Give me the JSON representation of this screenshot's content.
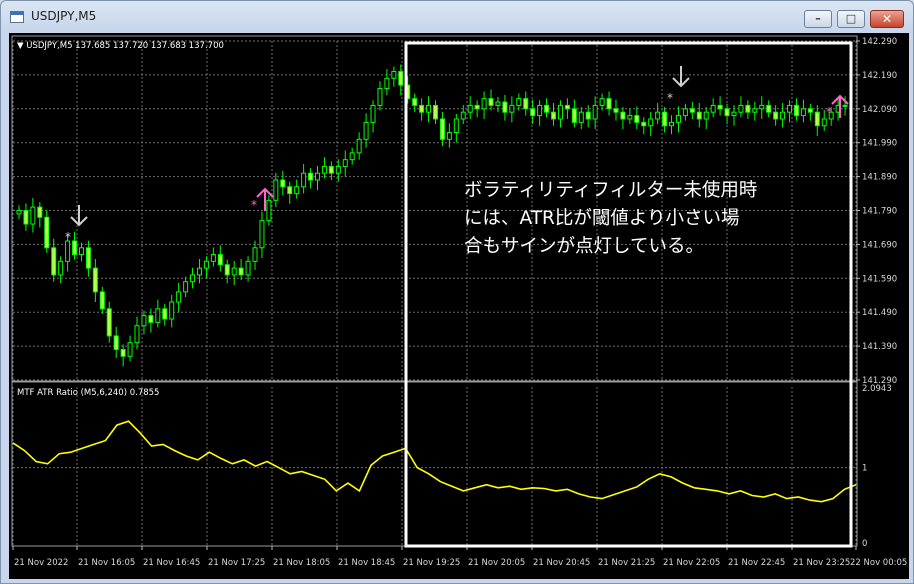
{
  "window": {
    "title": "USDJPY,M5",
    "icon": "chart-window-icon",
    "buttons": {
      "minimize": "–",
      "maximize": "□",
      "close": "✕"
    }
  },
  "price_panel": {
    "header": "▼ USDJPY,M5  137.685 137.720 137.683 137.700",
    "y_ticks": [
      "142.290",
      "142.190",
      "142.090",
      "141.990",
      "141.890",
      "141.790",
      "141.690",
      "141.590",
      "141.490",
      "141.390",
      "141.290"
    ]
  },
  "indicator_panel": {
    "header": "MTF ATR Ratio  (M5,6,240) 0.7855",
    "y_ticks": [
      "2.0943",
      "1",
      "0"
    ]
  },
  "x_ticks": [
    "21 Nov 2022",
    "21 Nov 16:05",
    "21 Nov 16:45",
    "21 Nov 17:25",
    "21 Nov 18:05",
    "21 Nov 18:45",
    "21 Nov 19:25",
    "21 Nov 20:05",
    "21 Nov 20:45",
    "21 Nov 21:25",
    "21 Nov 22:05",
    "21 Nov 22:45",
    "21 Nov 23:25",
    "22 Nov 00:05"
  ],
  "annotation": {
    "lines": [
      "ボラティリティフィルター未使用時",
      "には、ATR比が閾値より小さい場",
      "合もサインが点灯している。"
    ]
  },
  "colors": {
    "background": "#000000",
    "grid": "#6e6e6e",
    "candle": "#00ff00",
    "candle_body": "#b6ff4d",
    "atr_line": "#ffff00",
    "sell_signal": "#d0d0d0",
    "buy_signal": "#ff66cc",
    "highlight_box": "#ffffff"
  },
  "chart_data": [
    {
      "type": "candlestick",
      "title": "USDJPY,M5",
      "ylim": [
        141.29,
        142.29
      ],
      "signals": [
        {
          "kind": "sell",
          "x": "21 Nov 15:55",
          "price": 141.72
        },
        {
          "kind": "buy",
          "x": "21 Nov 17:25",
          "price": 141.78
        },
        {
          "kind": "sell",
          "x": "21 Nov 21:45",
          "price": 142.1
        },
        {
          "kind": "buy",
          "x": "21 Nov 23:55",
          "price": 142.02
        }
      ]
    },
    {
      "type": "line",
      "title": "MTF ATR Ratio  (M5,6,240) 0.7855",
      "ylim": [
        0,
        2.0943
      ],
      "values": [
        1.32,
        1.22,
        1.08,
        1.05,
        1.18,
        1.2,
        1.25,
        1.3,
        1.35,
        1.55,
        1.6,
        1.45,
        1.28,
        1.3,
        1.22,
        1.15,
        1.1,
        1.2,
        1.12,
        1.05,
        1.1,
        1.02,
        1.08,
        1.0,
        0.92,
        0.95,
        0.9,
        0.85,
        0.7,
        0.8,
        0.7,
        1.03,
        1.15,
        1.2,
        1.25,
        1.0,
        0.92,
        0.82,
        0.76,
        0.7,
        0.74,
        0.78,
        0.74,
        0.76,
        0.72,
        0.74,
        0.73,
        0.7,
        0.72,
        0.66,
        0.62,
        0.6,
        0.65,
        0.7,
        0.75,
        0.85,
        0.92,
        0.88,
        0.8,
        0.74,
        0.72,
        0.7,
        0.66,
        0.7,
        0.64,
        0.62,
        0.66,
        0.6,
        0.62,
        0.58,
        0.56,
        0.6,
        0.72,
        0.78
      ]
    }
  ]
}
